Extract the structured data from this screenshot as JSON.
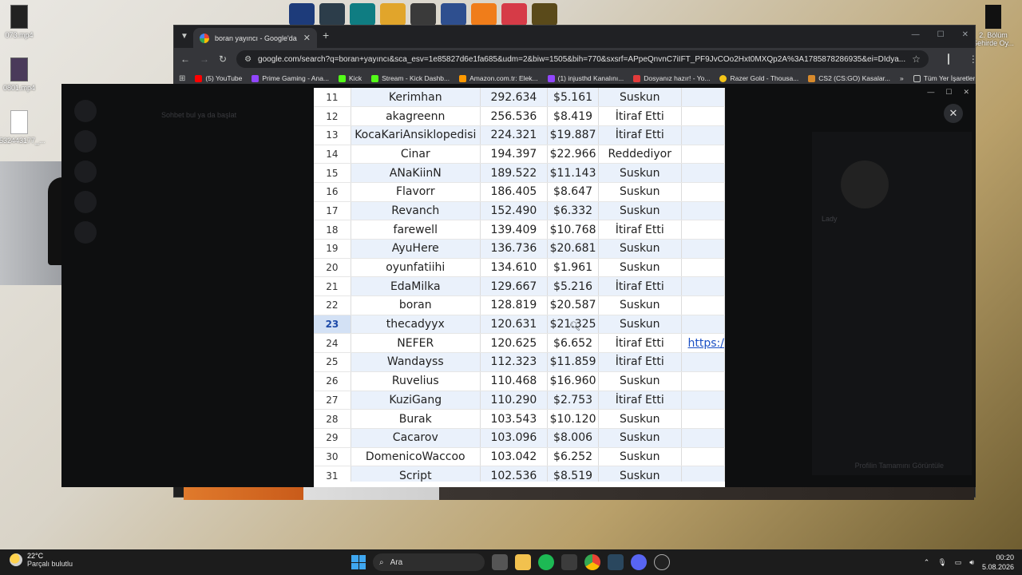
{
  "desktop": {
    "icons": [
      {
        "label": "073.mp4"
      },
      {
        "label": "0801.mp4"
      },
      {
        "label": "7532443177_..."
      }
    ],
    "right_icon": {
      "label": "2. Bölüm Şehirde Oy..."
    }
  },
  "browser": {
    "tab_title": "boran yayıncı - Google'da Ara",
    "url": "google.com/search?q=boran+yayıncı&sca_esv=1e85827d6e1fa685&udm=2&biw=1505&bih=770&sxsrf=APpeQnvnC7iIFT_PF9JvCOo2Hxt0MXQp2A%3A1785878286935&ei=DIdya...",
    "bookmarks": [
      {
        "label": "(5) YouTube",
        "color": "#ff0000"
      },
      {
        "label": "Prime Gaming - Ana...",
        "color": "#9146ff"
      },
      {
        "label": "Kick",
        "color": "#53fc18"
      },
      {
        "label": "Stream - Kick Dashb...",
        "color": "#53fc18"
      },
      {
        "label": "Amazon.com.tr: Elek...",
        "color": "#ff9900"
      },
      {
        "label": "(1) injusthd Kanalını...",
        "color": "#9146ff"
      },
      {
        "label": "Dosyanız hazır! - Yo...",
        "color": "#e23b3b"
      },
      {
        "label": "Razer Gold - Thousa...",
        "color": "#f5c518"
      },
      {
        "label": "CS2 (CS:GO) Kasalar...",
        "color": "#d88a2c"
      }
    ],
    "bookmarks_more": "»",
    "all_bookmarks": "Tüm Yer İşaretleri"
  },
  "overlay": {
    "search_faint": "Sohbet bul ya da başlat",
    "profile_faint": "Lady",
    "status_faint": "Profilin Tamamını Görüntüle"
  },
  "sheet": {
    "selected_row": "23",
    "rows": [
      {
        "n": "11",
        "name": "Kerimhan",
        "views": "292.634",
        "money": "$5.161",
        "status": "Suskun",
        "link": ""
      },
      {
        "n": "12",
        "name": "akagreenn",
        "views": "256.536",
        "money": "$8.419",
        "status": "İtiraf Etti",
        "link": ""
      },
      {
        "n": "13",
        "name": "KocaKariAnsiklopedisi",
        "views": "224.321",
        "money": "$19.887",
        "status": "İtiraf Etti",
        "link": ""
      },
      {
        "n": "14",
        "name": "Cinar",
        "views": "194.397",
        "money": "$22.966",
        "status": "Reddediyor",
        "link": ""
      },
      {
        "n": "15",
        "name": "ANaKiinN",
        "views": "189.522",
        "money": "$11.143",
        "status": "Suskun",
        "link": ""
      },
      {
        "n": "16",
        "name": "Flavorr",
        "views": "186.405",
        "money": "$8.647",
        "status": "Suskun",
        "link": ""
      },
      {
        "n": "17",
        "name": "Revanch",
        "views": "152.490",
        "money": "$6.332",
        "status": "Suskun",
        "link": ""
      },
      {
        "n": "18",
        "name": "farewell",
        "views": "139.409",
        "money": "$10.768",
        "status": "İtiraf Etti",
        "link": ""
      },
      {
        "n": "19",
        "name": "AyuHere",
        "views": "136.736",
        "money": "$20.681",
        "status": "Suskun",
        "link": ""
      },
      {
        "n": "20",
        "name": "oyunfatiihi",
        "views": "134.610",
        "money": "$1.961",
        "status": "Suskun",
        "link": ""
      },
      {
        "n": "21",
        "name": "EdaMilka",
        "views": "129.667",
        "money": "$5.216",
        "status": "İtiraf Etti",
        "link": ""
      },
      {
        "n": "22",
        "name": "boran",
        "views": "128.819",
        "money": "$20.587",
        "status": "Suskun",
        "link": ""
      },
      {
        "n": "23",
        "name": "thecadyyx",
        "views": "120.631",
        "money": "$21.325",
        "status": "Suskun",
        "link": ""
      },
      {
        "n": "24",
        "name": "NEFER",
        "views": "120.625",
        "money": "$6.652",
        "status": "İtiraf Etti",
        "link": "https:/"
      },
      {
        "n": "25",
        "name": "Wandayss",
        "views": "112.323",
        "money": "$11.859",
        "status": "İtiraf Etti",
        "link": ""
      },
      {
        "n": "26",
        "name": "Ruvelius",
        "views": "110.468",
        "money": "$16.960",
        "status": "Suskun",
        "link": ""
      },
      {
        "n": "27",
        "name": "KuziGang",
        "views": "110.290",
        "money": "$2.753",
        "status": "İtiraf Etti",
        "link": ""
      },
      {
        "n": "28",
        "name": "Burak",
        "views": "103.543",
        "money": "$10.120",
        "status": "Suskun",
        "link": ""
      },
      {
        "n": "29",
        "name": "Cacarov",
        "views": "103.096",
        "money": "$8.006",
        "status": "Suskun",
        "link": ""
      },
      {
        "n": "30",
        "name": "DomenicoWaccoo",
        "views": "103.042",
        "money": "$6.252",
        "status": "Suskun",
        "link": ""
      },
      {
        "n": "31",
        "name": "Script",
        "views": "102.536",
        "money": "$8.519",
        "status": "Suskun",
        "link": ""
      }
    ]
  },
  "taskbar": {
    "temperature": "22°C",
    "weather": "Parçalı bulutlu",
    "search_placeholder": "Ara",
    "time": "00:20",
    "date": "5.08.2026"
  }
}
